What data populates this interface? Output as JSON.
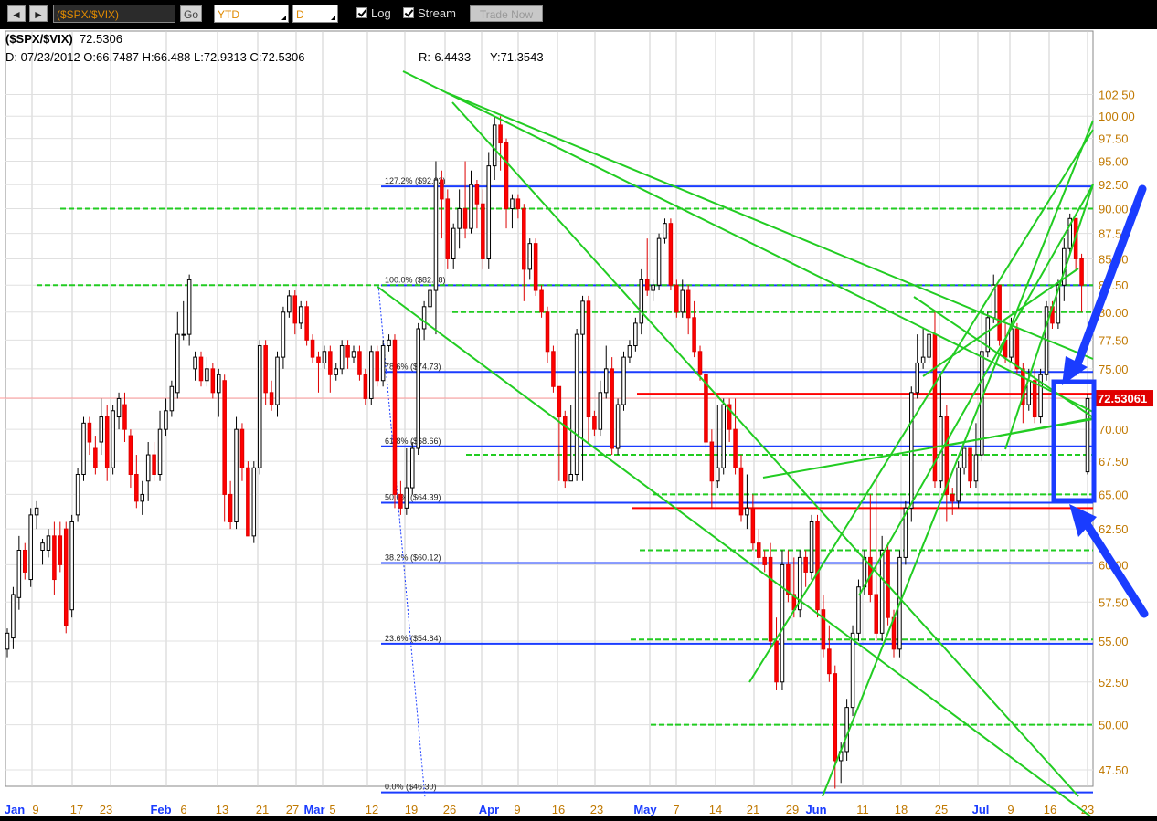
{
  "toolbar": {
    "prev_label": "◄",
    "next_label": "►",
    "symbol_value": "($SPX/$VIX)",
    "go_label": "Go",
    "period_value": "YTD",
    "interval_value": "D",
    "log_label": "Log",
    "log_checked": true,
    "stream_label": "Stream",
    "stream_checked": true,
    "trade_label": "Trade Now"
  },
  "header": {
    "symbol": "($SPX/$VIX)",
    "last": "72.5306",
    "ohlc_line": "D: 07/23/2012 O:66.7487 H:66.488 L:72.9313 C:72.5306",
    "r_value": "R:-6.4433",
    "y_value": "Y:71.3543"
  },
  "price_tag": "72.53061",
  "colors": {
    "up_candle": "#ffffff",
    "down_candle": "#ff0000",
    "fib_line": "#1a3cff",
    "trend_line": "#22cc22",
    "support_line": "#ff0000",
    "annotation": "#1a3cff",
    "month_label": "#1a3cff",
    "day_label": "#c07800"
  },
  "fib_levels": [
    {
      "label": "127.2% ($92.32)",
      "value": 92.32
    },
    {
      "label": "100.0% ($82.48)",
      "value": 82.48
    },
    {
      "label": "78.6% ($74.73)",
      "value": 74.73
    },
    {
      "label": "61.8% ($68.66)",
      "value": 68.66
    },
    {
      "label": "50.0% ($64.39)",
      "value": 64.39
    },
    {
      "label": "38.2% ($60.12)",
      "value": 60.12
    },
    {
      "label": "23.6% ($54.84)",
      "value": 54.84
    },
    {
      "label": "0.0% ($46.30)",
      "value": 46.3
    }
  ],
  "y_ticks": [
    "102.50",
    "100.00",
    "97.50",
    "95.00",
    "92.50",
    "90.00",
    "87.50",
    "85.00",
    "82.50",
    "80.00",
    "77.50",
    "75.00",
    "72.50",
    "70.00",
    "67.50",
    "65.00",
    "62.50",
    "60.00",
    "57.50",
    "55.00",
    "52.50",
    "50.00",
    "47.50"
  ],
  "x_labels": [
    {
      "text": "Jan",
      "month": true
    },
    {
      "text": "9",
      "month": false
    },
    {
      "text": "17",
      "month": false
    },
    {
      "text": "23",
      "month": false
    },
    {
      "text": "Feb",
      "month": true
    },
    {
      "text": "6",
      "month": false
    },
    {
      "text": "13",
      "month": false
    },
    {
      "text": "21",
      "month": false
    },
    {
      "text": "27",
      "month": false
    },
    {
      "text": "Mar",
      "month": true
    },
    {
      "text": "5",
      "month": false
    },
    {
      "text": "12",
      "month": false
    },
    {
      "text": "19",
      "month": false
    },
    {
      "text": "26",
      "month": false
    },
    {
      "text": "Apr",
      "month": true
    },
    {
      "text": "9",
      "month": false
    },
    {
      "text": "16",
      "month": false
    },
    {
      "text": "23",
      "month": false
    },
    {
      "text": "May",
      "month": true
    },
    {
      "text": "7",
      "month": false
    },
    {
      "text": "14",
      "month": false
    },
    {
      "text": "21",
      "month": false
    },
    {
      "text": "29",
      "month": false
    },
    {
      "text": "Jun",
      "month": true
    },
    {
      "text": "11",
      "month": false
    },
    {
      "text": "18",
      "month": false
    },
    {
      "text": "25",
      "month": false
    },
    {
      "text": "Jul",
      "month": true
    },
    {
      "text": "9",
      "month": false
    },
    {
      "text": "16",
      "month": false
    },
    {
      "text": "23",
      "month": false
    }
  ],
  "chart_data": {
    "type": "candlestick",
    "symbol": "($SPX/$VIX)",
    "period": "YTD",
    "interval": "D",
    "scale": "log",
    "ylim": [
      46,
      103.5
    ],
    "grid": true,
    "candles": [
      [
        54.5,
        55.5,
        54,
        55.8
      ],
      [
        55.2,
        58,
        54.5,
        58.5
      ],
      [
        57.8,
        61,
        57,
        62
      ],
      [
        61,
        59.5,
        59,
        61.5
      ],
      [
        59,
        63.5,
        58.5,
        64
      ],
      [
        63.5,
        64,
        62.5,
        64.5
      ],
      [
        61,
        61.5,
        60,
        61.8
      ],
      [
        61,
        62,
        60.5,
        62.5
      ],
      [
        62,
        59,
        58,
        63
      ],
      [
        62,
        60,
        59.5,
        63
      ],
      [
        62.5,
        56,
        55.5,
        63
      ],
      [
        57,
        63,
        56.5,
        63.5
      ],
      [
        63.5,
        66.5,
        63,
        67
      ],
      [
        66.5,
        70.5,
        66,
        71
      ],
      [
        70.5,
        69,
        68,
        71
      ],
      [
        68.5,
        67,
        66.5,
        69.5
      ],
      [
        69,
        71,
        68,
        72.5
      ],
      [
        71,
        67,
        66,
        72
      ],
      [
        67,
        71.5,
        66.5,
        72
      ],
      [
        71,
        72.5,
        70,
        73
      ],
      [
        72,
        70,
        69,
        73
      ],
      [
        69.5,
        66.5,
        65.5,
        70
      ],
      [
        66.5,
        64.5,
        64,
        68
      ],
      [
        64.5,
        65,
        63.5,
        66
      ],
      [
        66,
        68,
        64.5,
        69
      ],
      [
        68,
        66.5,
        66,
        69
      ],
      [
        66.5,
        70,
        66,
        71.5
      ],
      [
        70,
        71.5,
        69.5,
        72.5
      ],
      [
        71.5,
        73.5,
        71,
        74
      ],
      [
        73,
        78,
        72.5,
        80
      ],
      [
        78,
        78,
        77.5,
        81
      ],
      [
        78,
        83,
        77,
        83.5
      ],
      [
        75,
        76,
        74,
        76.5
      ],
      [
        76,
        74,
        73.5,
        76.5
      ],
      [
        74,
        75,
        73.5,
        76
      ],
      [
        75,
        73,
        72.5,
        75.5
      ],
      [
        73,
        74.5,
        71,
        75
      ],
      [
        74,
        65,
        63,
        74.5
      ],
      [
        65,
        63,
        62.5,
        66
      ],
      [
        63,
        70,
        62.5,
        71
      ],
      [
        70,
        67,
        66,
        70.5
      ],
      [
        67,
        62,
        62,
        67.5
      ],
      [
        62,
        67,
        61.5,
        67.5
      ],
      [
        67,
        77,
        66.5,
        77.5
      ],
      [
        77,
        73,
        72,
        77.5
      ],
      [
        73,
        72,
        71.5,
        74
      ],
      [
        72,
        76,
        71,
        76.5
      ],
      [
        76,
        80,
        75,
        80.5
      ],
      [
        80,
        81.5,
        79.5,
        82
      ],
      [
        81.5,
        79,
        78,
        82
      ],
      [
        79,
        80.5,
        78.5,
        81
      ],
      [
        80.5,
        77.5,
        77,
        81
      ],
      [
        77.5,
        76,
        75.5,
        78
      ],
      [
        76,
        75.5,
        73,
        76.5
      ],
      [
        75.5,
        76.5,
        75,
        77
      ],
      [
        76.5,
        74.5,
        73,
        77
      ],
      [
        74.5,
        75,
        74,
        75.5
      ],
      [
        75,
        77,
        74.5,
        77.5
      ],
      [
        77,
        76,
        75,
        77.5
      ],
      [
        76,
        76.5,
        75.5,
        77
      ],
      [
        76.5,
        74.5,
        74,
        77
      ],
      [
        74.5,
        72.5,
        72,
        75
      ],
      [
        72.5,
        76.5,
        72,
        77
      ],
      [
        76.5,
        74,
        73.5,
        77
      ],
      [
        74,
        77,
        73.5,
        77.5
      ],
      [
        77,
        77.5,
        76.5,
        78
      ],
      [
        77.5,
        65,
        64,
        78
      ],
      [
        65,
        64,
        63.5,
        66
      ],
      [
        64,
        65.5,
        63.5,
        68.5
      ],
      [
        65.5,
        68.5,
        65,
        69
      ],
      [
        68.5,
        78.5,
        68,
        79
      ],
      [
        78.5,
        80.5,
        77.5,
        81
      ],
      [
        80.5,
        82,
        80,
        82.5
      ],
      [
        82,
        93,
        78,
        95
      ],
      [
        93,
        91,
        87,
        94
      ],
      [
        91,
        85,
        84,
        92
      ],
      [
        85,
        88,
        84,
        88.5
      ],
      [
        88,
        90,
        86,
        92
      ],
      [
        90,
        88,
        87,
        95
      ],
      [
        88,
        92.5,
        87.5,
        94
      ],
      [
        92.5,
        90.5,
        88,
        93
      ],
      [
        90.5,
        85,
        84,
        92
      ],
      [
        85,
        94.5,
        84,
        96
      ],
      [
        94.5,
        99,
        93,
        100
      ],
      [
        99,
        97,
        94,
        100
      ],
      [
        97,
        90,
        88,
        97.5
      ],
      [
        90,
        91,
        88,
        91.5
      ],
      [
        91,
        90,
        89,
        91.5
      ],
      [
        90,
        84,
        81,
        90.5
      ],
      [
        84,
        86.5,
        83,
        87
      ],
      [
        86.5,
        82,
        81.5,
        87
      ],
      [
        82,
        80,
        79.5,
        82.5
      ],
      [
        80,
        76.5,
        75.5,
        80.5
      ],
      [
        76.5,
        73.5,
        73,
        77
      ],
      [
        73.5,
        71,
        66,
        73
      ],
      [
        71,
        66,
        65.5,
        71.5
      ],
      [
        66,
        66.5,
        66,
        72
      ],
      [
        66.5,
        78,
        66,
        78.5
      ],
      [
        78,
        81,
        66,
        81.5
      ],
      [
        81,
        71,
        69,
        81.5
      ],
      [
        71,
        70,
        69.5,
        71.5
      ],
      [
        70,
        73,
        69.5,
        74
      ],
      [
        73,
        75,
        72.5,
        77
      ],
      [
        75,
        68.5,
        68,
        76
      ],
      [
        68.5,
        72,
        68,
        72.5
      ],
      [
        72,
        76,
        71.5,
        76.5
      ],
      [
        76,
        77,
        75.5,
        77.5
      ],
      [
        77,
        79,
        76.5,
        79.5
      ],
      [
        79,
        83,
        78,
        84
      ],
      [
        83,
        82,
        81.5,
        87
      ],
      [
        82,
        82.5,
        81,
        83
      ],
      [
        82.5,
        87,
        82,
        87.5
      ],
      [
        87,
        88.5,
        86.5,
        89
      ],
      [
        88.5,
        82.5,
        82,
        89
      ],
      [
        82.5,
        80,
        79.5,
        83
      ],
      [
        80,
        82,
        79.5,
        83
      ],
      [
        82,
        79.5,
        78,
        82.5
      ],
      [
        79.5,
        76.5,
        76,
        81
      ],
      [
        76.5,
        74.5,
        74,
        77
      ],
      [
        74.5,
        69,
        68.5,
        75
      ],
      [
        69,
        66,
        64,
        70
      ],
      [
        66,
        67,
        65.5,
        72
      ],
      [
        67,
        72,
        66.5,
        72.5
      ],
      [
        72,
        70,
        69,
        72.5
      ],
      [
        70,
        67,
        66.5,
        72.5
      ],
      [
        67,
        63.5,
        63,
        68
      ],
      [
        63.5,
        64,
        62.5,
        66.5
      ],
      [
        64,
        61.5,
        61,
        65
      ],
      [
        61.5,
        60.5,
        60,
        62.5
      ],
      [
        60.5,
        60,
        59.5,
        61
      ],
      [
        60.5,
        55,
        54.5,
        61.5
      ],
      [
        55,
        52.5,
        52,
        56.5
      ],
      [
        52.5,
        60,
        52,
        61
      ],
      [
        60,
        58,
        57.5,
        61
      ],
      [
        58,
        57,
        56.5,
        60.5
      ],
      [
        57,
        60.5,
        56.5,
        61
      ],
      [
        60.5,
        59.5,
        58.5,
        61
      ],
      [
        59.5,
        63,
        59,
        63.5
      ],
      [
        63,
        57,
        56.5,
        63.5
      ],
      [
        57,
        54.5,
        54,
        58
      ],
      [
        54.5,
        53,
        52.5,
        56
      ],
      [
        53,
        48,
        46.5,
        53.5
      ],
      [
        48,
        48.5,
        46.8,
        49
      ],
      [
        48.5,
        51,
        48,
        51.5
      ],
      [
        51,
        55.5,
        50.5,
        56
      ],
      [
        55.5,
        58.5,
        55,
        59
      ],
      [
        58.5,
        60.5,
        58,
        61
      ],
      [
        60.5,
        58,
        57.5,
        65
      ],
      [
        58,
        55.5,
        55,
        66.5
      ],
      [
        55.5,
        61,
        55,
        62
      ],
      [
        61,
        56.5,
        56,
        61.5
      ],
      [
        56.5,
        54.5,
        54,
        57
      ],
      [
        54.5,
        60.5,
        54,
        61
      ],
      [
        60.5,
        64,
        60,
        64.5
      ],
      [
        64,
        73,
        63,
        73.5
      ],
      [
        73,
        75.5,
        72.5,
        78
      ],
      [
        75.5,
        76,
        75,
        78.5
      ],
      [
        76,
        78,
        75.5,
        78.5
      ],
      [
        78,
        66,
        65.5,
        80
      ],
      [
        66,
        71,
        65.5,
        74.5
      ],
      [
        71,
        65,
        63,
        72
      ],
      [
        65,
        64.5,
        63.5,
        65.5
      ],
      [
        64.5,
        67,
        64,
        67.5
      ],
      [
        67,
        68.5,
        66.5,
        68.5
      ],
      [
        68.5,
        66,
        65.5,
        68.5
      ],
      [
        66,
        68,
        65.5,
        70.5
      ],
      [
        68,
        76.5,
        67.5,
        80
      ],
      [
        76.5,
        79.5,
        76,
        80
      ],
      [
        79.5,
        82.5,
        79,
        83.5
      ],
      [
        82.5,
        77.5,
        77,
        82.5
      ],
      [
        77.5,
        76,
        75.5,
        79
      ],
      [
        76,
        78.5,
        75.5,
        79.5
      ],
      [
        78.5,
        75,
        74.5,
        79
      ],
      [
        75,
        72,
        70.5,
        75.5
      ],
      [
        72,
        74,
        71.5,
        75
      ],
      [
        74,
        71,
        70.5,
        75
      ],
      [
        71,
        74.5,
        70.5,
        75
      ],
      [
        74.5,
        80.5,
        74,
        81
      ],
      [
        80.5,
        79,
        78.5,
        81
      ],
      [
        79,
        82.5,
        78.5,
        83
      ],
      [
        82.5,
        86,
        81,
        87
      ],
      [
        86,
        89,
        85.5,
        89.5
      ],
      [
        89,
        85,
        84,
        85.5
      ],
      [
        85,
        82.5,
        80,
        85.5
      ],
      [
        66.7,
        72.5,
        66.5,
        72.9
      ]
    ]
  }
}
